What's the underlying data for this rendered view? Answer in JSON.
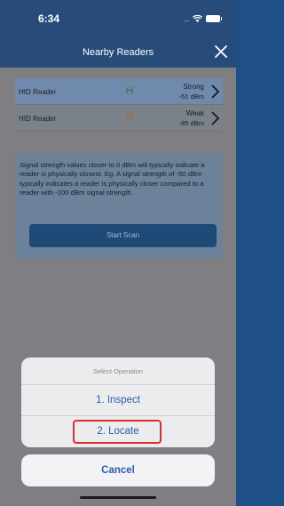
{
  "status_bar": {
    "time": "6:34",
    "signal_dots": "...."
  },
  "nav": {
    "title": "Nearby Readers"
  },
  "readers": [
    {
      "name": "HID Reader",
      "signal_glyph": "(•)",
      "strength_label": "Strong",
      "dbm": "-51 dBm",
      "color": "#2a7a2a"
    },
    {
      "name": "HID Reader",
      "signal_glyph": "(•)",
      "strength_label": "Weak",
      "dbm": "-85 dBm",
      "color": "#b86422"
    }
  ],
  "info": {
    "text": "Signal strength values closer to 0 dBm will typically indicate a reader is physically closest. Eg. A signal strength of -50 dBm typically indicates a reader is physically closer compared to a reader with -100 dBm signal strength.",
    "scan_button": "Start Scan"
  },
  "action_sheet": {
    "header": "Select Operation",
    "items": [
      "1. Inspect",
      "2. Locate"
    ],
    "highlighted_index": 1,
    "cancel": "Cancel"
  },
  "colors": {
    "nav_bg": "#274c7a",
    "accent": "#2a5da8",
    "highlight": "#d63031"
  }
}
